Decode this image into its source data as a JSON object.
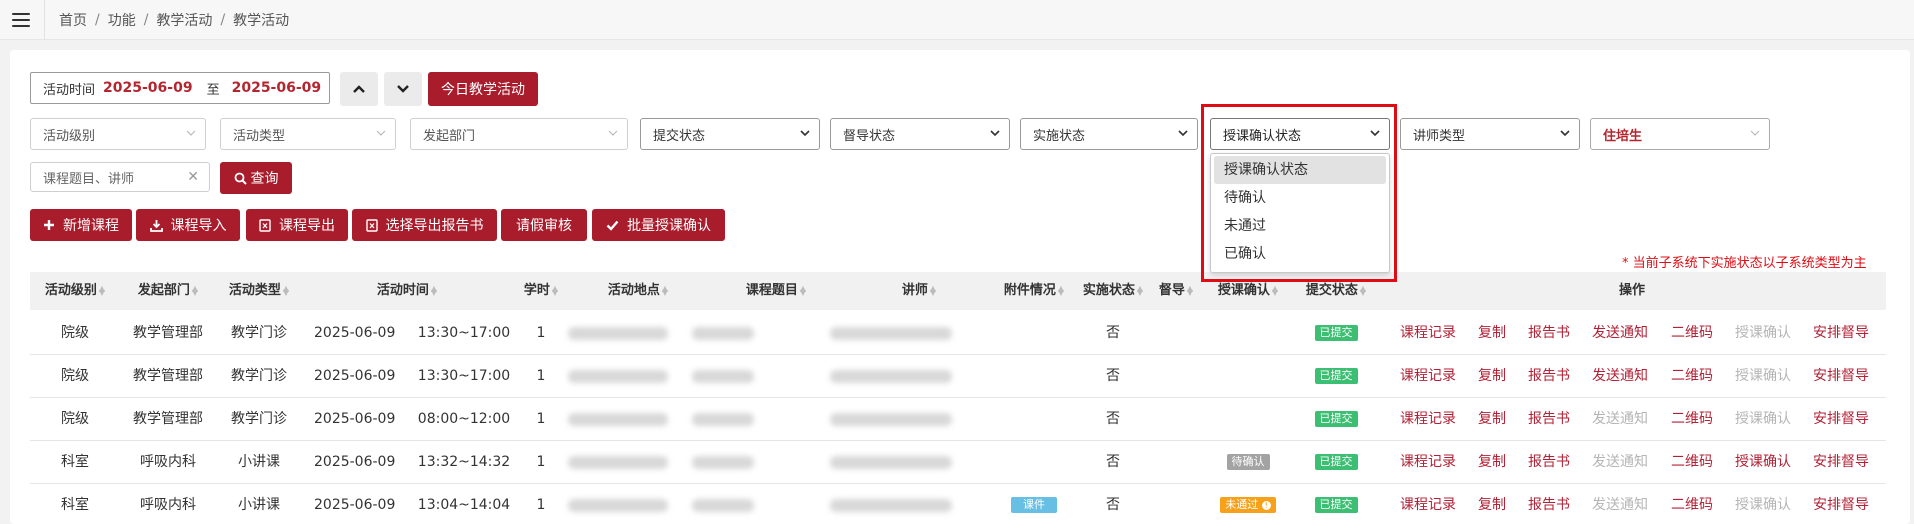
{
  "breadcrumb": [
    "首页",
    "功能",
    "教学活动",
    "教学活动"
  ],
  "date_filter": {
    "label": "活动时间",
    "start": "2025-06-09",
    "to": "至",
    "end": "2025-06-09"
  },
  "today_button": "今日教学活动",
  "filters": {
    "level": "活动级别",
    "type": "活动类型",
    "dept": "发起部门",
    "submit": "提交状态",
    "supervise": "督导状态",
    "implement": "实施状态",
    "confirm": "授课确认状态",
    "lecturer_type": "讲师类型",
    "trainee": "住培生"
  },
  "search": {
    "placeholder": "课程题目、讲师",
    "button": "查询"
  },
  "dropdown_options": [
    "授课确认状态",
    "待确认",
    "未通过",
    "已确认"
  ],
  "toolbar": [
    "新增课程",
    "课程导入",
    "课程导出",
    "选择导出报告书",
    "请假审核",
    "批量授课确认"
  ],
  "notice": "* 当前子系统下实施状态以子系统类型为主",
  "columns": [
    "活动级别",
    "发起部门",
    "活动类型",
    "活动时间",
    "学时",
    "活动地点",
    "课程题目",
    "讲师",
    "附件情况",
    "实施状态",
    "督导",
    "授课确认",
    "提交状态",
    "操作"
  ],
  "rows": [
    {
      "level": "院级",
      "dept": "教学管理部",
      "type": "教学门诊",
      "date": "2025-06-09",
      "time": "13:30~17:00",
      "hours": "1",
      "attach": "",
      "impl": "否",
      "confirm": "",
      "submit": "已提交",
      "notify_on": true,
      "confirm_on": false
    },
    {
      "level": "院级",
      "dept": "教学管理部",
      "type": "教学门诊",
      "date": "2025-06-09",
      "time": "13:30~17:00",
      "hours": "1",
      "attach": "",
      "impl": "否",
      "confirm": "",
      "submit": "已提交",
      "notify_on": true,
      "confirm_on": false
    },
    {
      "level": "院级",
      "dept": "教学管理部",
      "type": "教学门诊",
      "date": "2025-06-09",
      "time": "08:00~12:00",
      "hours": "1",
      "attach": "",
      "impl": "否",
      "confirm": "",
      "submit": "已提交",
      "notify_on": false,
      "confirm_on": false
    },
    {
      "level": "科室",
      "dept": "呼吸内科",
      "type": "小讲课",
      "date": "2025-06-09",
      "time": "13:32~14:32",
      "hours": "1",
      "attach": "",
      "impl": "否",
      "confirm": "待确认",
      "submit": "已提交",
      "notify_on": false,
      "confirm_on": true
    },
    {
      "level": "科室",
      "dept": "呼吸内科",
      "type": "小讲课",
      "date": "2025-06-09",
      "time": "13:04~14:04",
      "hours": "1",
      "attach": "课件",
      "impl": "否",
      "confirm": "未通过",
      "submit": "已提交",
      "notify_on": false,
      "confirm_on": false
    }
  ],
  "row_actions": [
    "课程记录",
    "复制",
    "报告书",
    "发送通知",
    "二维码",
    "授课确认",
    "安排督导"
  ],
  "colors": {
    "primary": "#a91c2c",
    "link": "#b22236",
    "highlight": "#e00c14",
    "badge_green": "#3cbf73",
    "badge_gray": "#a3a3a3",
    "badge_orange": "#f7a11a",
    "badge_blue": "#67bfe4"
  }
}
